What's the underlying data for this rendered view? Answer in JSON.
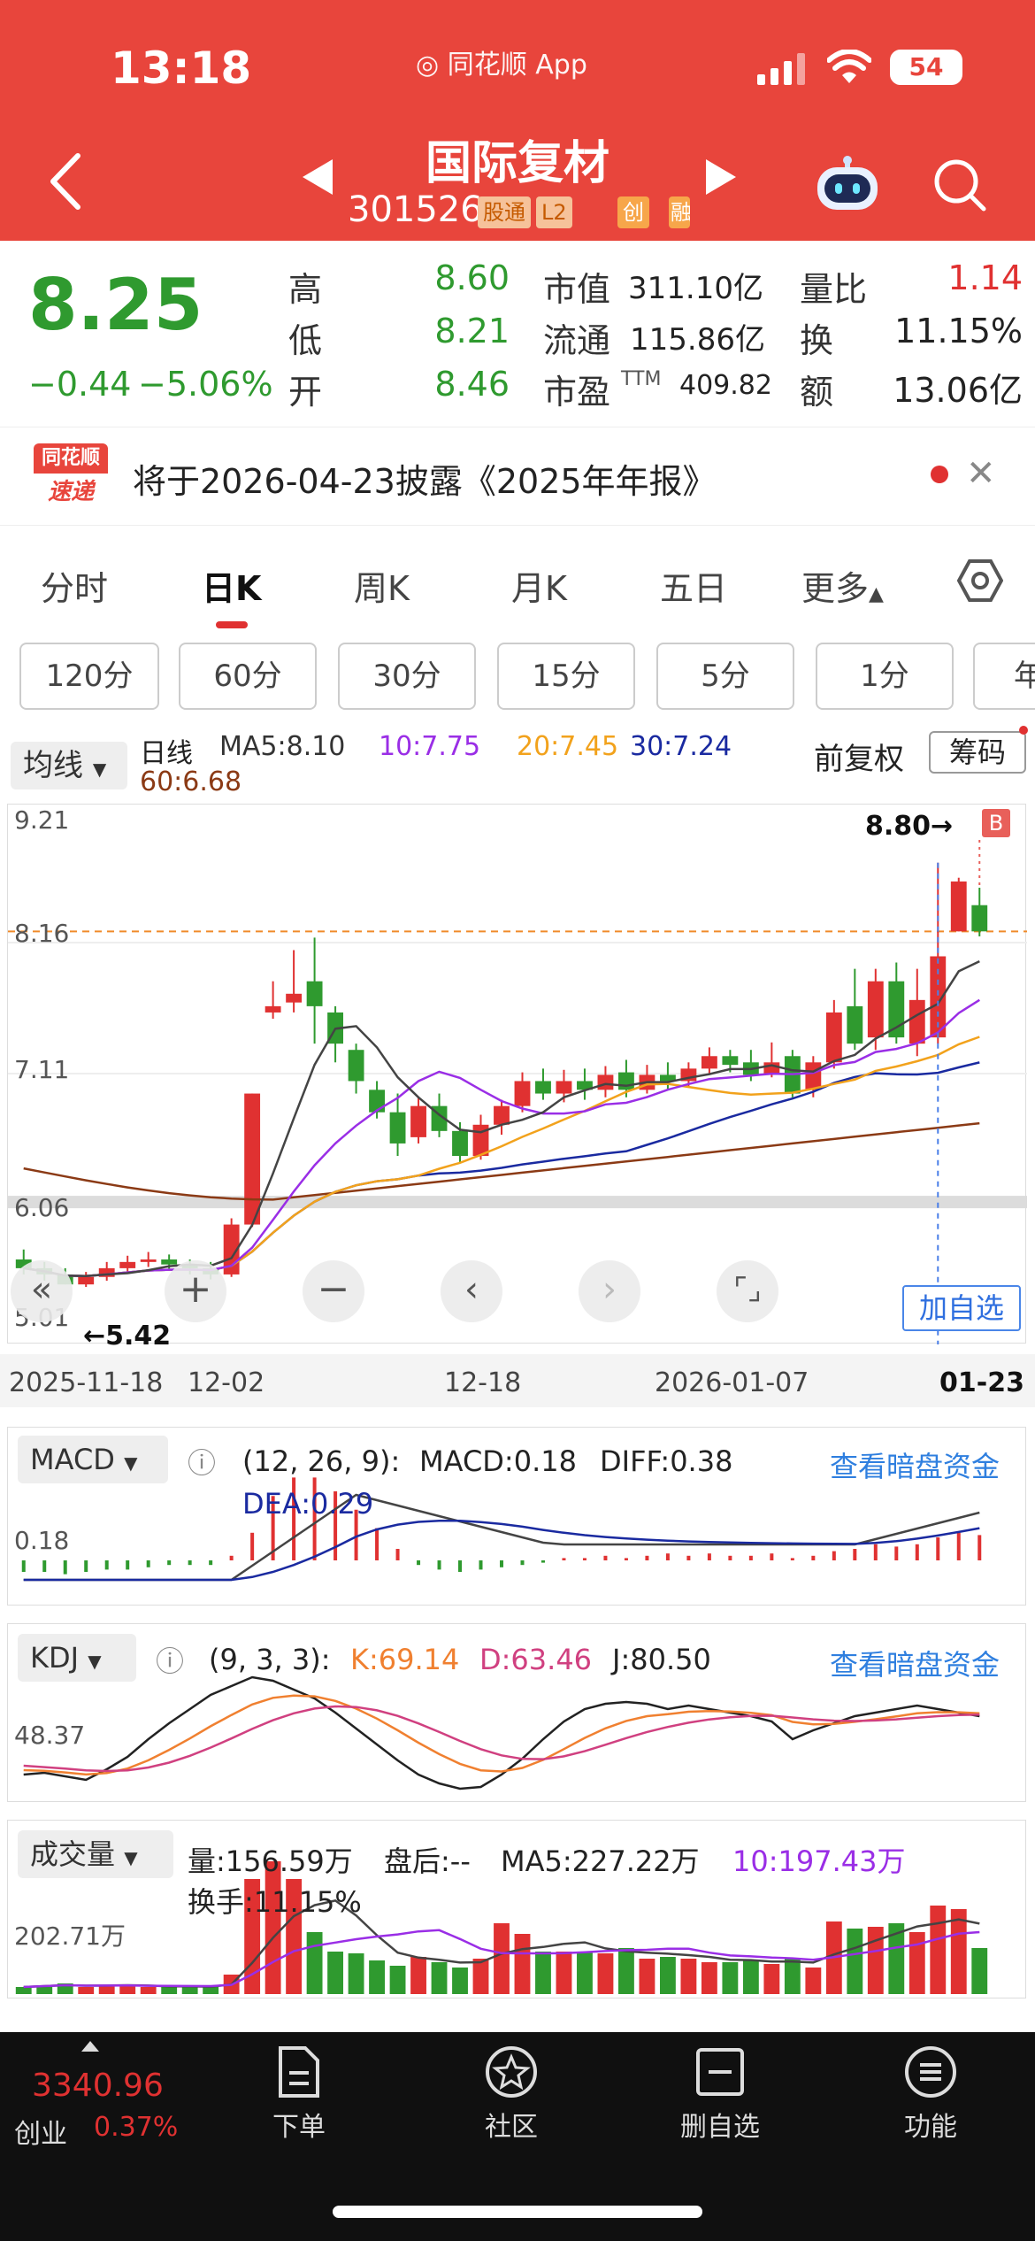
{
  "status_bar": {
    "time": "13:18",
    "app_label": "同花顺 App",
    "battery": "54"
  },
  "header": {
    "stock_name": "国际复材",
    "stock_code": "301526",
    "tags": [
      "股通",
      "L2",
      "创",
      "融"
    ]
  },
  "quote": {
    "price": "8.25",
    "change": "−0.44",
    "change_pct": "−5.06%",
    "high_label": "高",
    "high": "8.60",
    "low_label": "低",
    "low": "8.21",
    "open_label": "开",
    "open": "8.46",
    "mktcap_label": "市值",
    "mktcap": "311.10亿",
    "float_label": "流通",
    "float": "115.86亿",
    "pe_label": "市盈",
    "pe_sup": "TTM",
    "pe": "409.82",
    "volratio_label": "量比",
    "volratio": "1.14",
    "turnover_label": "换",
    "turnover": "11.15%",
    "amount_label": "额",
    "amount": "13.06亿"
  },
  "notice": {
    "logo_top": "同花顺",
    "logo_bottom": "速递",
    "text": "将于2026-04-23披露《2025年年报》"
  },
  "period_tabs": [
    "分时",
    "日K",
    "周K",
    "月K",
    "五日",
    "更多"
  ],
  "minute_buttons": [
    "120分",
    "60分",
    "30分",
    "15分",
    "5分",
    "1分",
    "年"
  ],
  "ma_bar": {
    "select": "均线",
    "daily": "日线",
    "ma5": "MA5:8.10",
    "ma10": "10:7.75",
    "ma20": "20:7.45",
    "ma30": "30:7.24",
    "ma60": "60:6.68",
    "adjust": "前复权",
    "chips": "筹码"
  },
  "kchart": {
    "y_labels": [
      "9.21",
      "8.16",
      "7.11",
      "6.06",
      "5.01"
    ],
    "high_marker": "8.80→",
    "low_marker": "←5.42",
    "b_marker": "B",
    "add_watchlist": "加自选",
    "dates": [
      "2025-11-18",
      "12-02",
      "12-18",
      "2026-01-07",
      "01-23"
    ]
  },
  "macd": {
    "select": "MACD",
    "params": "(12, 26, 9):",
    "macd": "MACD:0.18",
    "diff": "DIFF:0.38",
    "dea": "DEA:0.29",
    "link": "查看暗盘资金",
    "y_label": "0.18"
  },
  "kdj": {
    "select": "KDJ",
    "params": "(9, 3, 3):",
    "k": "K:69.14",
    "d": "D:63.46",
    "j": "J:80.50",
    "link": "查看暗盘资金",
    "y_label": "48.37"
  },
  "volume": {
    "select": "成交量",
    "vol": "量:156.59万",
    "after": "盘后:--",
    "ma5": "MA5:227.22万",
    "ma10": "10:197.43万",
    "turnover": "换手:11.15%",
    "y_label": "202.71万"
  },
  "bottom_nav": {
    "index_value": "3340.96",
    "index_name": "创业",
    "index_pct": "0.37%",
    "items": [
      "下单",
      "社区",
      "删自选",
      "功能"
    ]
  },
  "chart_data": {
    "type": "candlestick",
    "title": "",
    "ylim": [
      5.01,
      9.21
    ],
    "candles": [
      {
        "o": 5.62,
        "c": 5.55,
        "h": 5.7,
        "l": 5.5
      },
      {
        "o": 5.55,
        "c": 5.5,
        "h": 5.6,
        "l": 5.45
      },
      {
        "o": 5.5,
        "c": 5.42,
        "h": 5.55,
        "l": 5.42
      },
      {
        "o": 5.42,
        "c": 5.48,
        "h": 5.52,
        "l": 5.4
      },
      {
        "o": 5.48,
        "c": 5.55,
        "h": 5.6,
        "l": 5.45
      },
      {
        "o": 5.55,
        "c": 5.6,
        "h": 5.65,
        "l": 5.52
      },
      {
        "o": 5.6,
        "c": 5.62,
        "h": 5.68,
        "l": 5.56
      },
      {
        "o": 5.62,
        "c": 5.58,
        "h": 5.66,
        "l": 5.54
      },
      {
        "o": 5.58,
        "c": 5.55,
        "h": 5.62,
        "l": 5.5
      },
      {
        "o": 5.55,
        "c": 5.5,
        "h": 5.6,
        "l": 5.46
      },
      {
        "o": 5.5,
        "c": 5.9,
        "h": 5.95,
        "l": 5.48
      },
      {
        "o": 5.9,
        "c": 6.95,
        "h": 6.95,
        "l": 5.88
      },
      {
        "o": 7.6,
        "c": 7.65,
        "h": 7.85,
        "l": 7.55
      },
      {
        "o": 7.68,
        "c": 7.75,
        "h": 8.1,
        "l": 7.6
      },
      {
        "o": 7.85,
        "c": 7.65,
        "h": 8.2,
        "l": 7.35
      },
      {
        "o": 7.6,
        "c": 7.35,
        "h": 7.65,
        "l": 7.2
      },
      {
        "o": 7.3,
        "c": 7.05,
        "h": 7.35,
        "l": 6.95
      },
      {
        "o": 6.98,
        "c": 6.8,
        "h": 7.05,
        "l": 6.75
      },
      {
        "o": 6.8,
        "c": 6.55,
        "h": 6.95,
        "l": 6.45
      },
      {
        "o": 6.6,
        "c": 6.85,
        "h": 6.92,
        "l": 6.55
      },
      {
        "o": 6.85,
        "c": 6.65,
        "h": 6.95,
        "l": 6.6
      },
      {
        "o": 6.65,
        "c": 6.45,
        "h": 6.72,
        "l": 6.4
      },
      {
        "o": 6.45,
        "c": 6.7,
        "h": 6.78,
        "l": 6.42
      },
      {
        "o": 6.7,
        "c": 6.85,
        "h": 6.9,
        "l": 6.62
      },
      {
        "o": 6.85,
        "c": 7.05,
        "h": 7.12,
        "l": 6.8
      },
      {
        "o": 7.05,
        "c": 6.95,
        "h": 7.15,
        "l": 6.9
      },
      {
        "o": 6.95,
        "c": 7.05,
        "h": 7.14,
        "l": 6.88
      },
      {
        "o": 7.05,
        "c": 6.98,
        "h": 7.15,
        "l": 6.9
      },
      {
        "o": 6.98,
        "c": 7.1,
        "h": 7.17,
        "l": 6.92
      },
      {
        "o": 7.12,
        "c": 6.98,
        "h": 7.22,
        "l": 6.92
      },
      {
        "o": 6.98,
        "c": 7.1,
        "h": 7.18,
        "l": 6.95
      },
      {
        "o": 7.1,
        "c": 7.05,
        "h": 7.2,
        "l": 6.98
      },
      {
        "o": 7.05,
        "c": 7.15,
        "h": 7.2,
        "l": 7.0
      },
      {
        "o": 7.15,
        "c": 7.25,
        "h": 7.32,
        "l": 7.1
      },
      {
        "o": 7.25,
        "c": 7.18,
        "h": 7.3,
        "l": 7.12
      },
      {
        "o": 7.2,
        "c": 7.1,
        "h": 7.3,
        "l": 7.05
      },
      {
        "o": 7.1,
        "c": 7.2,
        "h": 7.36,
        "l": 7.08
      },
      {
        "o": 7.25,
        "c": 6.95,
        "h": 7.3,
        "l": 6.92
      },
      {
        "o": 6.98,
        "c": 7.2,
        "h": 7.25,
        "l": 6.92
      },
      {
        "o": 7.2,
        "c": 7.6,
        "h": 7.7,
        "l": 7.15
      },
      {
        "o": 7.65,
        "c": 7.35,
        "h": 7.95,
        "l": 7.3
      },
      {
        "o": 7.4,
        "c": 7.85,
        "h": 7.95,
        "l": 7.3
      },
      {
        "o": 7.85,
        "c": 7.4,
        "h": 8.0,
        "l": 7.35
      },
      {
        "o": 7.35,
        "c": 7.7,
        "h": 7.95,
        "l": 7.25
      },
      {
        "o": 7.4,
        "c": 8.05,
        "h": 8.8,
        "l": 7.35
      },
      {
        "o": 8.25,
        "c": 8.65,
        "h": 8.68,
        "l": 8.25
      },
      {
        "o": 8.46,
        "c": 8.25,
        "h": 8.6,
        "l": 8.21
      }
    ]
  }
}
